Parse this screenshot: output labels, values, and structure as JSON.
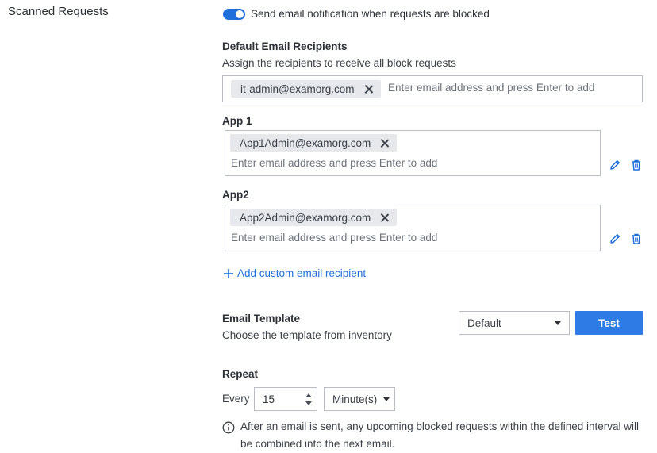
{
  "section": {
    "title": "Scanned Requests"
  },
  "notify": {
    "label": "Send email notification when requests are blocked",
    "enabled": true
  },
  "default_recipients": {
    "heading": "Default Email Recipients",
    "description": "Assign the recipients to receive all block requests",
    "chips": [
      "it-admin@examorg.com"
    ],
    "placeholder": "Enter email address and press Enter to add"
  },
  "apps": [
    {
      "name": "App 1",
      "chips": [
        "App1Admin@examorg.com"
      ],
      "placeholder": "Enter email address and press Enter to add"
    },
    {
      "name": "App2",
      "chips": [
        "App2Admin@examorg.com"
      ],
      "placeholder": "Enter email address and press Enter to add"
    }
  ],
  "add_custom": {
    "label": "Add custom email recipient"
  },
  "template": {
    "heading": "Email Template",
    "description": "Choose the template from inventory",
    "selected": "Default",
    "test_label": "Test"
  },
  "repeat": {
    "heading": "Repeat",
    "every_label": "Every",
    "value": "15",
    "unit": "Minute(s)"
  },
  "info": {
    "line1": "After an email is sent, any upcoming blocked requests within the defined interval will",
    "line2": "be combined into the next email."
  },
  "colors": {
    "accent": "#1f6fdb",
    "button": "#2e7be6",
    "chip_bg": "#e6e8ec",
    "border": "#b9bec6"
  }
}
